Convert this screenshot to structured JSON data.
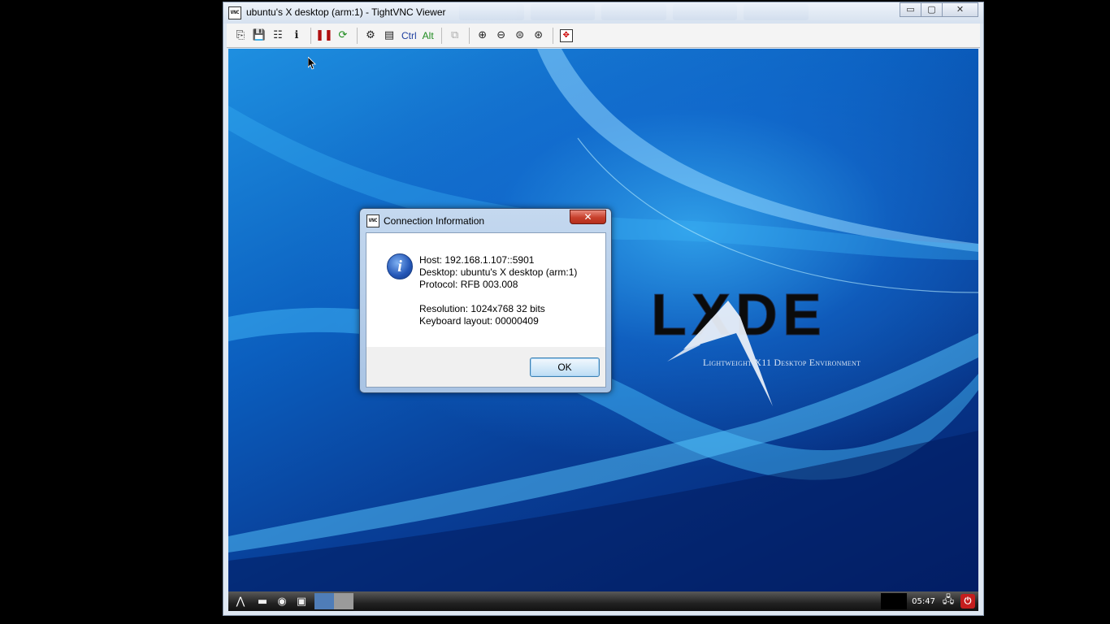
{
  "window": {
    "title": "ubuntu's X desktop (arm:1) - TightVNC Viewer",
    "controls": {
      "minimize": "▭",
      "maximize": "▢",
      "close": "✕"
    }
  },
  "toolbar": {
    "ctrl_label": "Ctrl",
    "alt_label": "Alt",
    "buttons": [
      "new-connection-icon",
      "save-icon",
      "options-icon",
      "connection-info-icon",
      "pause-icon",
      "refresh-icon",
      "ctrl-alt-del-icon",
      "send-ctrl-esc-icon",
      "copy-icon",
      "zoom-in-icon",
      "zoom-out-icon",
      "zoom-100-icon",
      "zoom-auto-icon",
      "fullscreen-icon"
    ]
  },
  "desktop": {
    "logo_text": "LXDE",
    "tagline": "Lightweight X11 Desktop Environment",
    "panel": {
      "clock": "05:47"
    }
  },
  "dialog": {
    "title": "Connection Information",
    "host": "Host: 192.168.1.107::5901",
    "desktop": "Desktop: ubuntu's X desktop (arm:1)",
    "protocol": "Protocol: RFB 003.008",
    "resolution": "Resolution: 1024x768 32 bits",
    "keyboard": "Keyboard layout: 00000409",
    "ok_label": "OK",
    "close_glyph": "✕",
    "icon_glyph": "i"
  }
}
